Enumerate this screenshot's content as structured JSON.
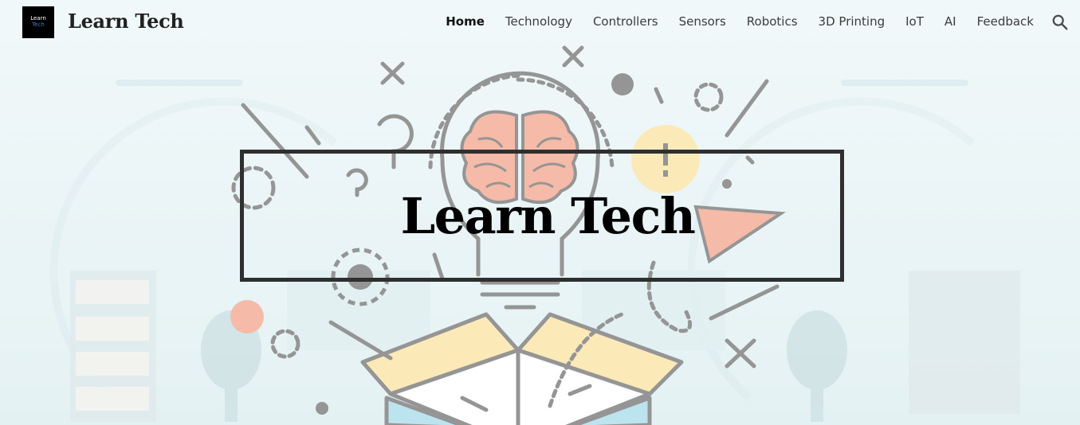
{
  "header": {
    "logo_line1": "Learn",
    "logo_line2": "Tech",
    "site_title": "Learn Tech"
  },
  "nav": {
    "items": [
      {
        "label": "Home",
        "active": true
      },
      {
        "label": "Technology"
      },
      {
        "label": "Controllers"
      },
      {
        "label": "Sensors"
      },
      {
        "label": "Robotics"
      },
      {
        "label": "3D Printing"
      },
      {
        "label": "IoT"
      },
      {
        "label": "AI"
      },
      {
        "label": "Feedback"
      }
    ],
    "search_icon": "search-icon"
  },
  "hero": {
    "title": "Learn Tech",
    "illustration": "idea-lightbulb-brain-illustration"
  },
  "colors": {
    "outline": "#8c8c8c",
    "brain": "#f5b5a1",
    "yellow": "#fbe9b2",
    "title_border": "#2f2f2f"
  }
}
